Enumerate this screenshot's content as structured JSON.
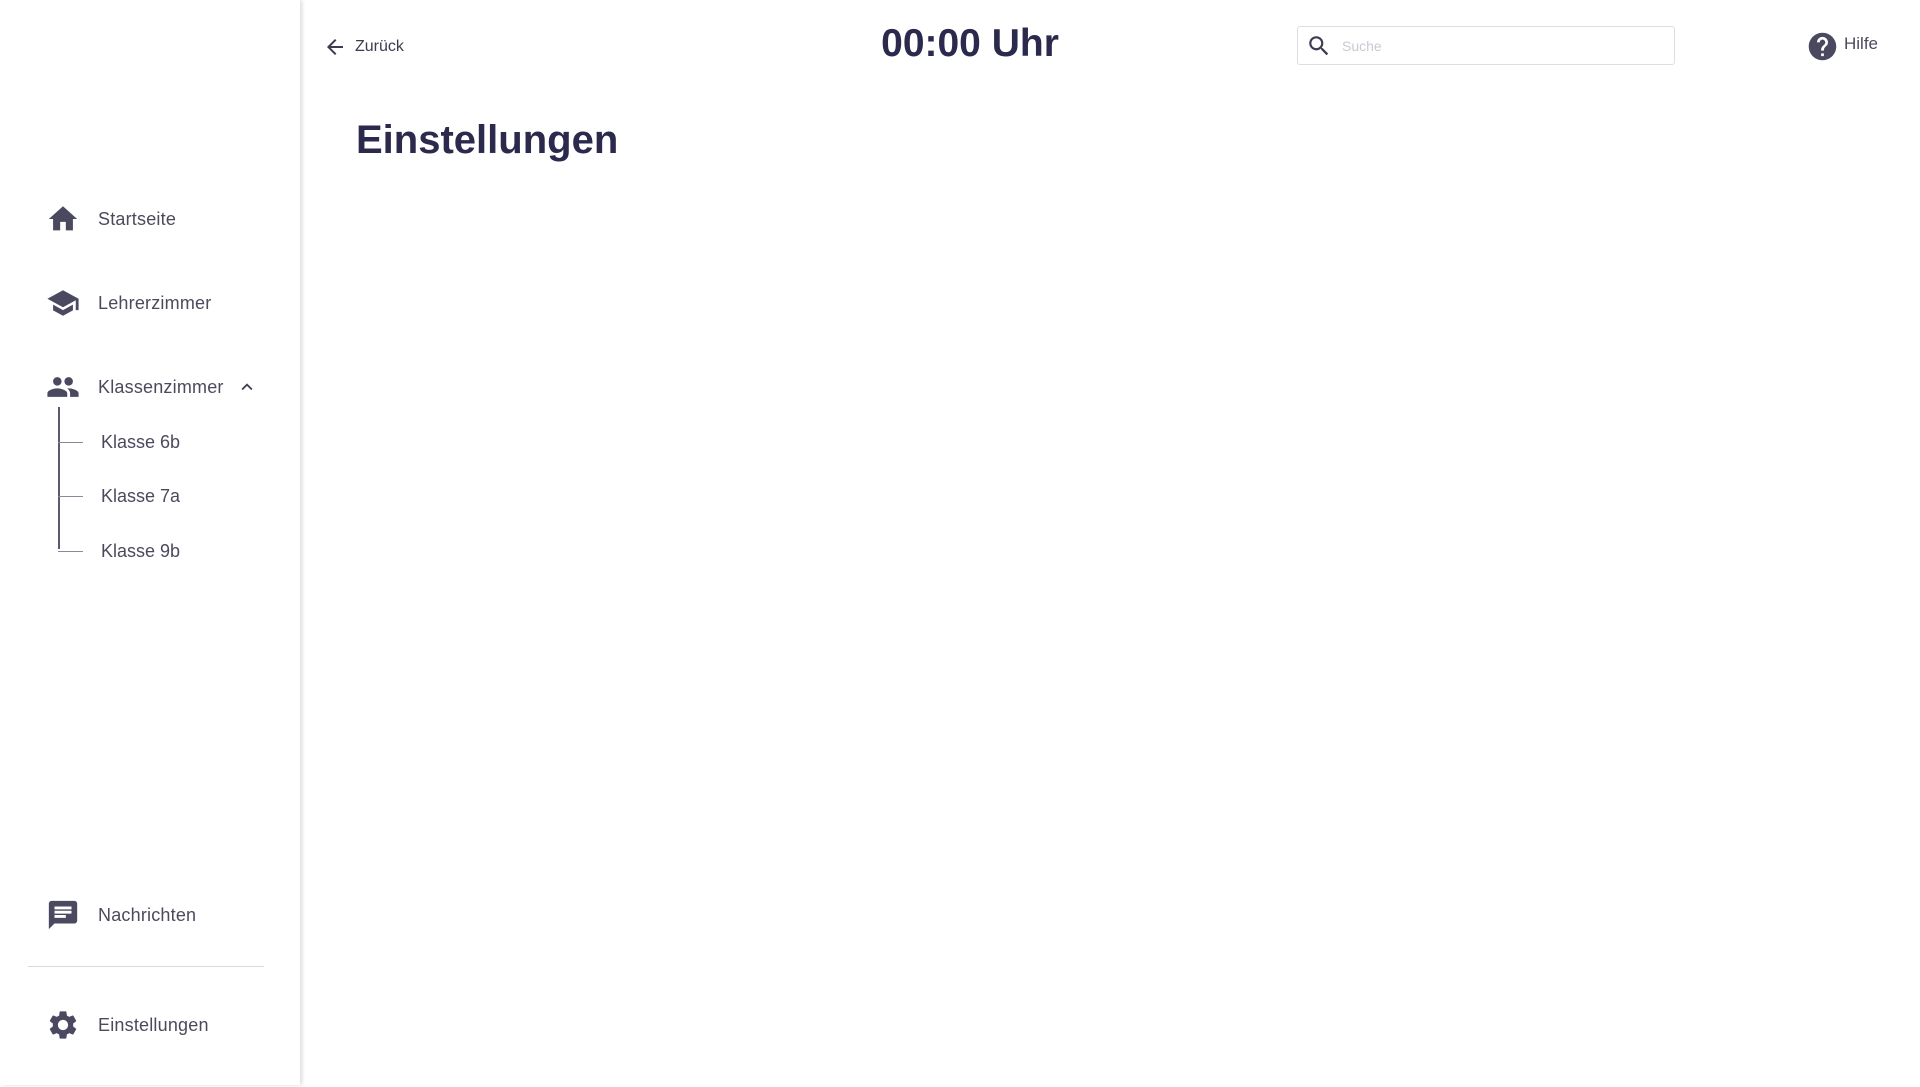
{
  "header": {
    "back_label": "Zurück",
    "clock": "00:00 Uhr",
    "search_placeholder": "Suche",
    "help_label": "Hilfe"
  },
  "page": {
    "title": "Einstellungen"
  },
  "sidebar": {
    "items": [
      {
        "label": "Startseite",
        "icon": "home-icon"
      },
      {
        "label": "Lehrerzimmer",
        "icon": "school-icon"
      },
      {
        "label": "Klassenzimmer",
        "icon": "people-icon",
        "expanded": true
      }
    ],
    "sub_items": [
      {
        "label": "Klasse 6b"
      },
      {
        "label": "Klasse 7a"
      },
      {
        "label": "Klasse 9b"
      }
    ],
    "bottom_items": [
      {
        "label": "Nachrichten",
        "icon": "message-icon"
      },
      {
        "label": "Einstellungen",
        "icon": "gear-icon"
      }
    ]
  },
  "colors": {
    "primary_text": "#2b2a4c",
    "icon": "#4a4960",
    "background": "#ffffff"
  }
}
